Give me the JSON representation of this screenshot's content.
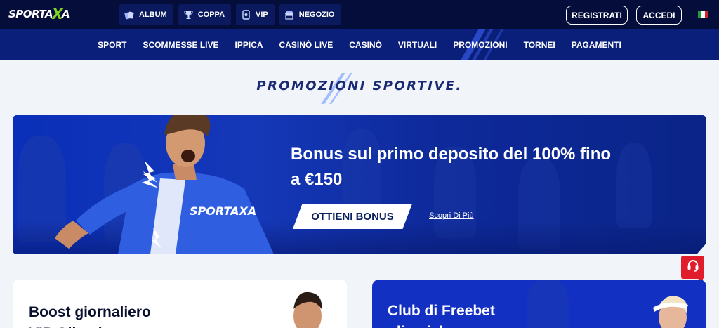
{
  "brand": {
    "logo_text": "SPORTAXA",
    "logo_part1": "SPORTA",
    "logo_part2": "X",
    "logo_part3": "A"
  },
  "topnav": [
    {
      "label": "ALBUM",
      "icon": "album-icon"
    },
    {
      "label": "COPPA",
      "icon": "trophy-icon"
    },
    {
      "label": "VIP",
      "icon": "vip-icon"
    },
    {
      "label": "NEGOZIO",
      "icon": "shop-icon"
    }
  ],
  "auth": {
    "register_label": "REGISTRATI",
    "login_label": "ACCEDI"
  },
  "language": {
    "icon": "italy-flag-icon"
  },
  "mainnav": [
    "SPORT",
    "SCOMMESSE LIVE",
    "IPPICA",
    "CASINÒ LIVE",
    "CASINÒ",
    "VIRTUALI",
    "PROMOZIONI",
    "TORNEI",
    "PAGAMENTI"
  ],
  "section": {
    "title": "PROMOZIONI SPORTIVE."
  },
  "hero": {
    "title": "Bonus sul primo deposito del 100% fino a €150",
    "cta_label": "OTTIENI BONUS",
    "link_label": "Scopri Di Più",
    "jersey_text": "SPORTAXA"
  },
  "cards": [
    {
      "title": "Boost giornaliero\nVIP Olimpico"
    },
    {
      "title": "Club di Freebet\nolimpiche"
    }
  ],
  "chat": {
    "icon": "headset-icon"
  },
  "colors": {
    "navy": "#050d3a",
    "nav_blue": "#0a1f7a",
    "accent_green": "#7fd321",
    "chat_red": "#e21d2b"
  }
}
